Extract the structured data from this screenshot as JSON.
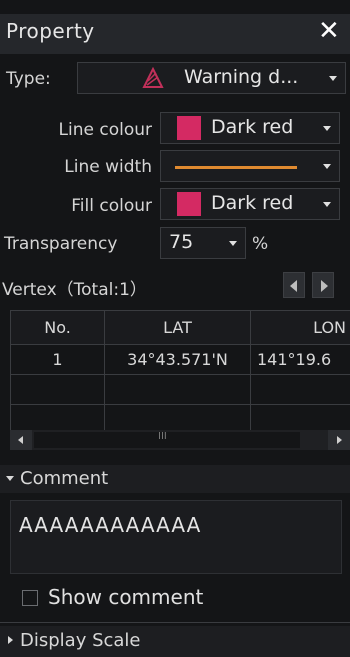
{
  "header": {
    "title": "Property"
  },
  "type_row": {
    "label": "Type:",
    "value": "Warning d...",
    "icon": "warning-area-icon"
  },
  "line_colour": {
    "label": "Line colour",
    "value": "Dark red",
    "swatch": "#d42a63"
  },
  "line_width": {
    "label": "Line width",
    "line_color": "#e08a30"
  },
  "fill_colour": {
    "label": "Fill colour",
    "value": "Dark red",
    "swatch": "#d42a63"
  },
  "transparency": {
    "label": "Transparency",
    "value": "75",
    "unit": "%"
  },
  "vertex": {
    "title": "Vertex（Total:1）",
    "columns": [
      "No.",
      "LAT",
      "LON"
    ],
    "rows": [
      {
        "no": "1",
        "lat": "34°43.571'N",
        "lon": "141°19.6"
      }
    ],
    "scroll_mid": "III"
  },
  "comment": {
    "header": "Comment",
    "text": "AAAAAAAAAAAA",
    "show_label": "Show comment",
    "show_checked": false
  },
  "display_scale": {
    "header": "Display Scale"
  }
}
